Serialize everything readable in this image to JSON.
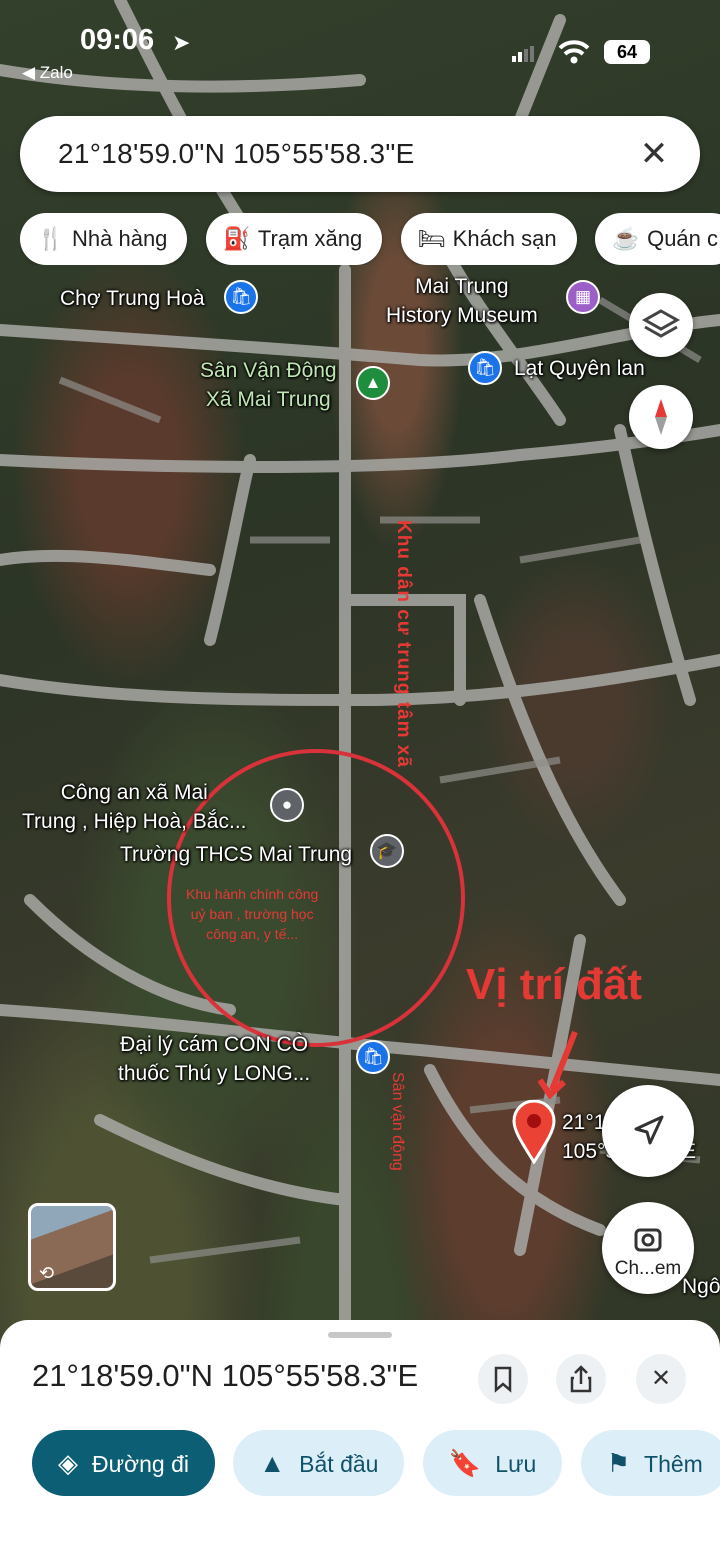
{
  "status_bar": {
    "time": "09:06",
    "back_app": "◀ Zalo",
    "battery": "64"
  },
  "search": {
    "query": "21°18'59.0\"N 105°55'58.3\"E"
  },
  "chips": [
    {
      "icon": "restaurant-icon",
      "glyph": "🍴",
      "label": "Nhà hàng"
    },
    {
      "icon": "gas-station-icon",
      "glyph": "⛽",
      "label": "Trạm xăng"
    },
    {
      "icon": "bed-icon",
      "glyph": "🛏",
      "label": "Khách sạn"
    },
    {
      "icon": "coffee-icon",
      "glyph": "☕",
      "label": "Quán c"
    }
  ],
  "map_labels": {
    "cho_trung_hoa": "Chợ Trung Hoà",
    "museum_line1": "Mai Trung",
    "museum_line2": "History Museum",
    "stadium_line1": "Sân Vận Động",
    "stadium_line2": "Xã Mai Trung",
    "lat_quyen": "Lạt Quyên lan",
    "police_line1": "Công an xã Mai",
    "police_line2": "Trung , Hiệp Hoà, Bắc...",
    "school": "Trường THCS Mai Trung",
    "shop_line1": "Đại lý cám CON CÒ",
    "shop_line2": "thuốc Thú y LONG...",
    "dropped_pin_line1": "21°18",
    "dropped_pin_line2": "105°5",
    "dropped_pin_suffix": "E",
    "edge_label": "Ngô"
  },
  "annotations": {
    "road_label": "Khu dân cư trung tâm xã",
    "admin_line1": "Khu hành chính công",
    "admin_line2": "uỷ ban , trường học",
    "admin_line3": "công an, y tế...",
    "land_location": "Vị trí đất",
    "sport_field": "Sân vận động"
  },
  "floating": {
    "camera_label": "Ch...em"
  },
  "sheet": {
    "coords": "21°18'59.0\"N 105°55'58.3\"E",
    "actions": [
      {
        "icon": "directions-icon",
        "glyph": "◈",
        "label": "Đường đi",
        "primary": true
      },
      {
        "icon": "navigate-icon",
        "glyph": "▲",
        "label": "Bắt đầu"
      },
      {
        "icon": "bookmark-icon",
        "glyph": "🔖",
        "label": "Lưu"
      },
      {
        "icon": "flag-icon",
        "glyph": "⚑",
        "label": "Thêm"
      }
    ]
  },
  "colors": {
    "accent": "#0b5e73",
    "annotation_red": "#e53935",
    "pin_blue": "#1a73e8"
  }
}
